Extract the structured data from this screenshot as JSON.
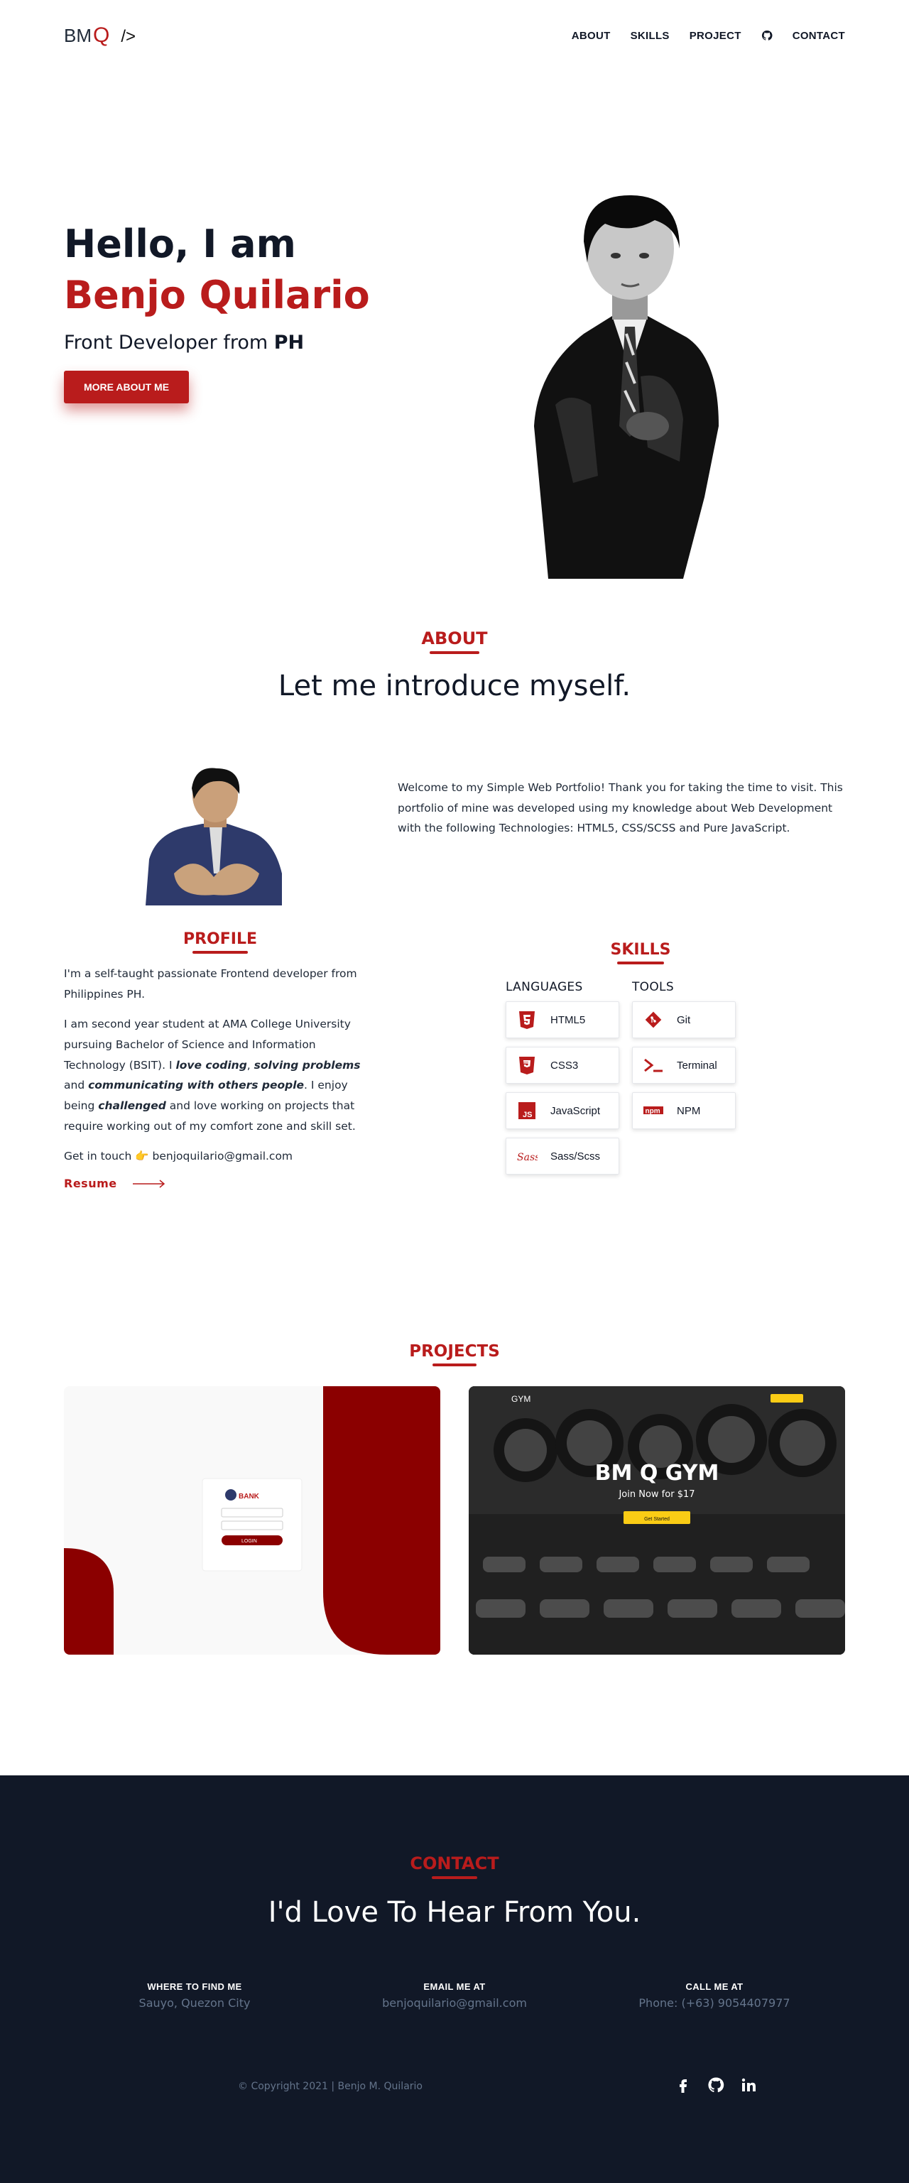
{
  "nav": {
    "logo_main": "BM",
    "logo_q": "Q",
    "logo_tag": "/>",
    "links": [
      "ABOUT",
      "SKILLS",
      "PROJECT",
      "CONTACT"
    ]
  },
  "hero": {
    "hello": "Hello, I am",
    "name": "Benjo Quilario",
    "sub_prefix": "Front Developer from ",
    "sub_bold": "PH",
    "button": "MORE ABOUT ME"
  },
  "about": {
    "label": "ABOUT",
    "title": "Let me introduce myself.",
    "intro": "Welcome to my Simple Web Portfolio! Thank you for taking the time to visit. This portfolio of mine was developed using my knowledge about Web Development with the following Technologies: HTML5, CSS/SCSS and Pure JavaScript.",
    "profile_label": "PROFILE",
    "p1": "I'm a self-taught passionate Frontend developer from Philippines PH.",
    "p2_a": "I am second year student at AMA College University pursuing Bachelor of Science and Information Technology (BSIT). I ",
    "p2_b": "love coding",
    "p2_c": ", ",
    "p2_d": "solving problems",
    "p2_e": " and ",
    "p2_f": "communicating with others people",
    "p2_g": ". I enjoy being ",
    "p2_h": "challenged",
    "p2_i": " and love working on projects that require working out of my comfort zone and skill set.",
    "get_in_touch": "Get in touch",
    "email": "benjoquilario@gmail.com",
    "resume": "Resume"
  },
  "skills": {
    "label": "SKILLS",
    "languages_head": "LANGUAGES",
    "tools_head": "TOOLS",
    "languages": [
      "HTML5",
      "CSS3",
      "JavaScript",
      "Sass/Scss"
    ],
    "tools": [
      "Git",
      "Terminal",
      "NPM"
    ]
  },
  "projects": {
    "label": "PROJECTS",
    "bank_logo": "BANK",
    "bank_login": "LOGIN",
    "gym_brand": "GYM",
    "gym_title": "BM Q GYM",
    "gym_sub": "Join Now for $17",
    "gym_button": "Get Started"
  },
  "contact": {
    "label": "CONTACT",
    "title": "I'd Love To Hear From You.",
    "where_head": "WHERE TO FIND ME",
    "where_val": "Sauyo, Quezon City",
    "email_head": "EMAIL ME AT",
    "email_val": "benjoquilario@gmail.com",
    "call_head": "CALL ME AT",
    "call_val": "Phone: (+63) 9054407977",
    "copyright": "© Copyright 2021 | Benjo M. Quilario"
  },
  "colors": {
    "accent": "#b91c1c",
    "dark": "#111827",
    "muted": "#64748b"
  }
}
